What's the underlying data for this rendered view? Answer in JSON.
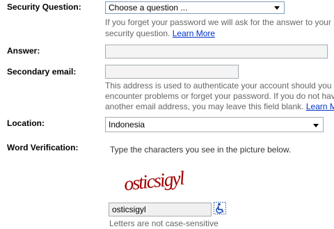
{
  "security_question": {
    "label": "Security Question:",
    "selected": "Choose a question ...",
    "help_line1": "If you forget your password we will ask for the answer to your",
    "help_line2": "security question.",
    "learn_more": "Learn More"
  },
  "answer": {
    "label": "Answer:",
    "value": ""
  },
  "secondary_email": {
    "label": "Secondary email:",
    "value": "",
    "help_line1": "This address is used to authenticate your account should you",
    "help_line2": "encounter problems or forget your password. If you do not have",
    "help_line3": "another email address, you may leave this field blank.",
    "learn_more": "Learn More"
  },
  "location": {
    "label": "Location:",
    "selected": "Indonesia"
  },
  "word_verification": {
    "label": "Word Verification:",
    "instruction": "Type the characters you see in the picture below.",
    "captcha_text": "osticsigyl",
    "input_value": "osticsigyl",
    "case_note": "Letters are not case-sensitive"
  },
  "colors": {
    "link": "#0033cc",
    "help_text": "#666666",
    "accessibility_icon": "#1a4db3"
  }
}
